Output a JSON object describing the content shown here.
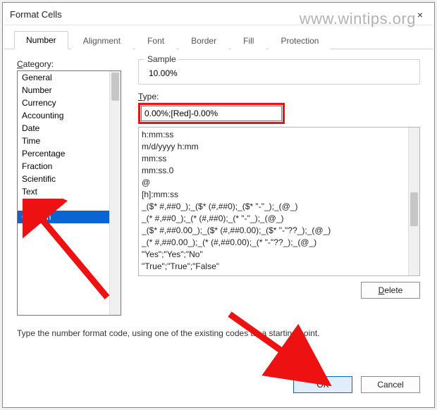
{
  "window": {
    "title": "Format Cells",
    "close_label": "×"
  },
  "watermark": "www.wintips.org",
  "tabs": [
    {
      "label": "Number",
      "active": true
    },
    {
      "label": "Alignment",
      "active": false
    },
    {
      "label": "Font",
      "active": false
    },
    {
      "label": "Border",
      "active": false
    },
    {
      "label": "Fill",
      "active": false
    },
    {
      "label": "Protection",
      "active": false
    }
  ],
  "category": {
    "label": "Category:",
    "items": [
      "General",
      "Number",
      "Currency",
      "Accounting",
      "Date",
      "Time",
      "Percentage",
      "Fraction",
      "Scientific",
      "Text",
      "Special",
      "Custom"
    ],
    "selected": "Custom"
  },
  "sample": {
    "legend": "Sample",
    "value": "10.00%"
  },
  "type": {
    "label": "Type:",
    "value": "0.00%;[Red]-0.00%",
    "formats": [
      "h:mm:ss",
      "m/d/yyyy h:mm",
      "mm:ss",
      "mm:ss.0",
      "@",
      "[h]:mm:ss",
      "_($* #,##0_);_($* (#,##0);_($* \"-\"_);_(@_)",
      "_(* #,##0_);_(* (#,##0);_(* \"-\"_);_(@_)",
      "_($* #,##0.00_);_($* (#,##0.00);_($* \"-\"??_);_(@_)",
      "_(* #,##0.00_);_(* (#,##0.00);_(* \"-\"??_);_(@_)",
      "\"Yes\";\"Yes\";\"No\"",
      "\"True\";\"True\";\"False\""
    ]
  },
  "buttons": {
    "delete": "Delete",
    "ok": "OK",
    "cancel": "Cancel"
  },
  "hint": "Type the number format code, using one of the existing codes as a starting point."
}
